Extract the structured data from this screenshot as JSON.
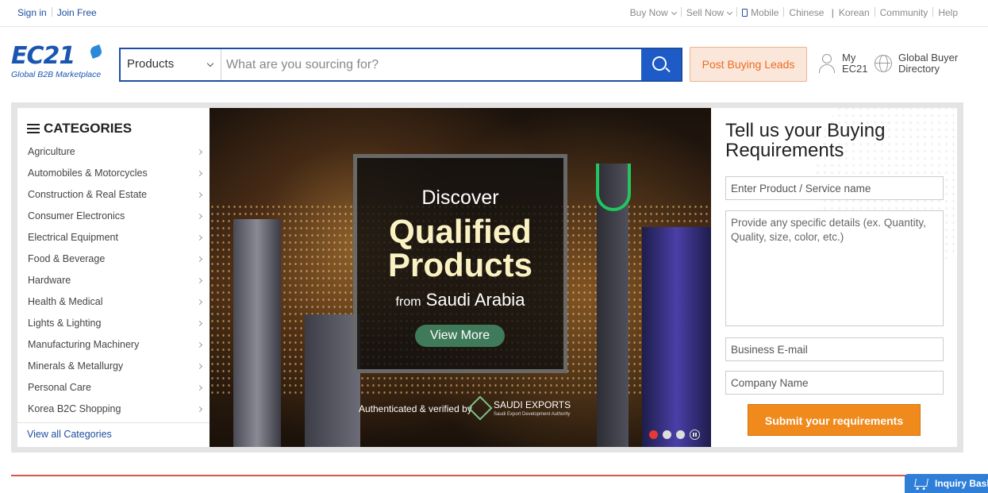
{
  "topbar": {
    "sign_in": "Sign in",
    "join_free": "Join Free",
    "buy_now": "Buy Now",
    "sell_now": "Sell Now",
    "mobile": "Mobile",
    "chinese": "Chinese",
    "divider": "|",
    "korean": "Korean",
    "community": "Community",
    "help": "Help"
  },
  "logo": {
    "mark": "EC21",
    "tagline": "Global B2B Marketplace"
  },
  "search": {
    "category": "Products",
    "placeholder": "What are you sourcing for?"
  },
  "header": {
    "post_buying_leads": "Post Buying Leads",
    "my_ec21_line1": "My",
    "my_ec21_line2": "EC21",
    "gbd_line1": "Global Buyer",
    "gbd_line2": "Directory"
  },
  "categories": {
    "title": "CATEGORIES",
    "items": [
      "Agriculture",
      "Automobiles & Motorcycles",
      "Construction & Real Estate",
      "Consumer Electronics",
      "Electrical Equipment",
      "Food & Beverage",
      "Hardware",
      "Health & Medical",
      "Lights & Lighting",
      "Manufacturing Machinery",
      "Minerals & Metallurgy",
      "Personal Care",
      "Korea B2C Shopping"
    ],
    "view_all": "View all Categories"
  },
  "banner": {
    "line1": "Discover",
    "line2": "Qualified",
    "line3": "Products",
    "line4_from": "from",
    "line4_place": "Saudi Arabia",
    "view_more": "View More",
    "authenticated": "Authenticated & verified by",
    "partner_name": "SAUDI EXPORTS",
    "partner_sub": "Saudi Export Development Authority",
    "slides_total": 3,
    "slide_active": 1
  },
  "requirements": {
    "title": "Tell us your Buying Requirements",
    "product_placeholder": "Enter Product / Service name",
    "details_placeholder": "Provide any specific details (ex. Quantity, Quality, size, color, etc.)",
    "email_placeholder": "Business E-mail",
    "company_placeholder": "Company Name",
    "submit": "Submit your requirements"
  },
  "inquiry_basket": "Inquiry Basket",
  "colors": {
    "brand_blue": "#1e4ea1",
    "accent_orange": "#f08a1c",
    "post_leads_text": "#ef6a1f",
    "active_dot": "#e53935"
  }
}
